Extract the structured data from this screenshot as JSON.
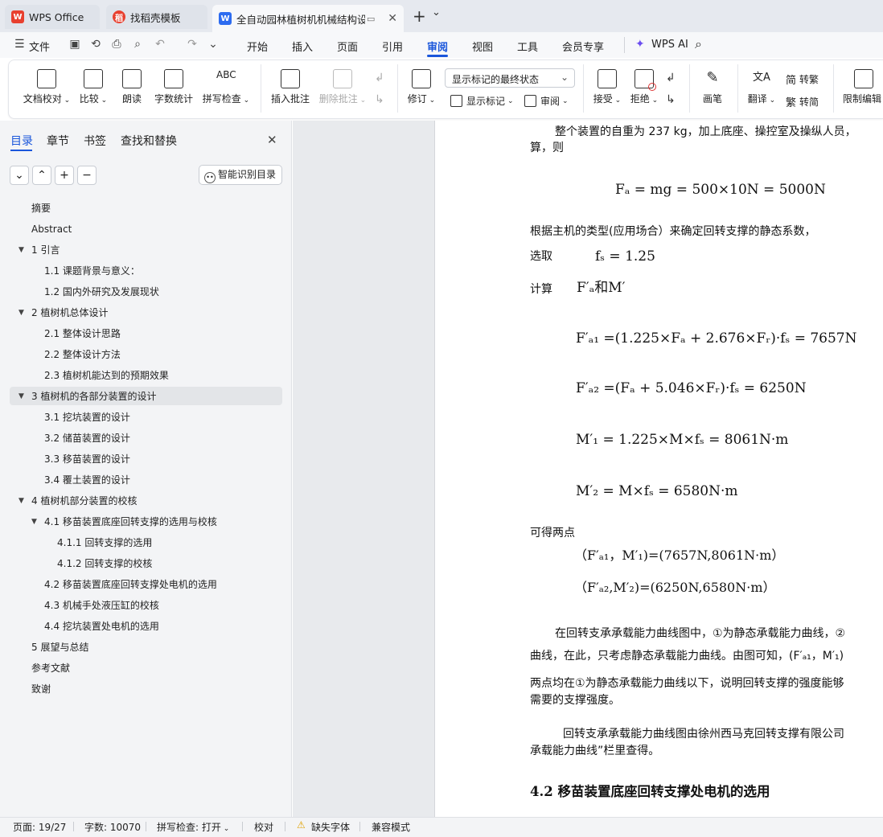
{
  "titlebar": {
    "tabs": [
      {
        "label": "WPS Office",
        "icon": "wps-logo-icon"
      },
      {
        "label": "找稻壳模板",
        "icon": "docer-icon"
      },
      {
        "label": "全自动园林植树机机械结构设计",
        "icon": "writer-doc-icon",
        "active": true
      }
    ],
    "new_tab": "+",
    "tab_menu": "⌄"
  },
  "menubar": {
    "file": "文件",
    "items": [
      "开始",
      "插入",
      "页面",
      "引用",
      "审阅",
      "视图",
      "工具",
      "会员专享"
    ],
    "active": "审阅",
    "wps_ai": "WPS AI"
  },
  "ribbon": {
    "proof": "文档校对",
    "compare": "比较",
    "read_aloud": "朗读",
    "word_count": "字数统计",
    "spell_check": "拼写检查",
    "insert_comment": "插入批注",
    "delete_comment": "删除批注",
    "track_changes": "修订",
    "markup_state": "显示标记的最终状态",
    "show_markup": "显示标记",
    "review": "审阅",
    "accept": "接受",
    "reject": "拒绝",
    "pen": "画笔",
    "translate": "翻译",
    "to_traditional": "转繁",
    "to_simplified": "转简",
    "restrict_edit": "限制编辑"
  },
  "panel": {
    "tabs": [
      "目录",
      "章节",
      "书签",
      "查找和替换"
    ],
    "active_tab": "目录",
    "smart_toc": "智能识别目录",
    "toc": [
      {
        "label": "摘要",
        "level": 0
      },
      {
        "label": "Abstract",
        "level": 0
      },
      {
        "label": "1  引言",
        "level": 0,
        "expanded": true
      },
      {
        "label": "1.1  课题背景与意义：",
        "level": 1
      },
      {
        "label": "1.2  国内外研究及发展现状",
        "level": 1
      },
      {
        "label": "2  植树机总体设计",
        "level": 0,
        "expanded": true
      },
      {
        "label": "2.1    整体设计思路",
        "level": 1
      },
      {
        "label": "2.2  整体设计方法",
        "level": 1
      },
      {
        "label": "2.3 植树机能达到的预期效果",
        "level": 1
      },
      {
        "label": "3    植树机的各部分装置的设计",
        "level": 0,
        "expanded": true,
        "selected": true
      },
      {
        "label": "3.1  挖坑装置的设计",
        "level": 1
      },
      {
        "label": "3.2  储苗装置的设计",
        "level": 1
      },
      {
        "label": "3.3    移苗装置的设计",
        "level": 1
      },
      {
        "label": "3.4    覆土装置的设计",
        "level": 1
      },
      {
        "label": "4    植树机部分装置的校核",
        "level": 0,
        "expanded": true
      },
      {
        "label": "4.1  移苗装置底座回转支撑的选用与校核",
        "level": 1,
        "expanded": true
      },
      {
        "label": "4.1.1  回转支撑的选用",
        "level": 2
      },
      {
        "label": "4.1.2 回转支撑的校核",
        "level": 2
      },
      {
        "label": "4.2 移苗装置底座回转支撑处电机的选用",
        "level": 1
      },
      {
        "label": "4.3  机械手处液压缸的校核",
        "level": 1
      },
      {
        "label": "4.4 挖坑装置处电机的选用",
        "level": 1
      },
      {
        "label": "5    展望与总结",
        "level": 0
      },
      {
        "label": "参考文献",
        "level": 0
      },
      {
        "label": "致谢",
        "level": 0
      }
    ]
  },
  "doc": {
    "p1": "整个装置的自重为 237 kg，加上底座、操控室及操纵人员，",
    "p1b": "算，则",
    "eq_fa": "Fₐ = mg = 500×10N = 5000N",
    "p2": "根据主机的类型(应用场合）来确定回转支撑的静态系数，",
    "p3_label": "选取",
    "eq_fs": "fₛ = 1.25",
    "p4_label": "计算",
    "eq_fam": "F′ₐ和M′",
    "eq1": "F′ₐ₁ =(1.225×Fₐ + 2.676×Fᵣ)·fₛ = 7657N",
    "eq2": "F′ₐ₂ =(Fₐ + 5.046×Fᵣ)·fₛ = 6250N",
    "eq3": "M′₁ = 1.225×M×fₛ = 8061N·m",
    "eq4": "M′₂ = M×fₛ = 6580N·m",
    "p5": "可得两点",
    "pt1": "（F′ₐ₁，M′₁)=(7657N,8061N·m）",
    "pt2": "（F′ₐ₂,M′₂)=(6250N,6580N·m）",
    "p6a": "在回转支承承载能力曲线图中，①为静态承载能力曲线，②",
    "p6b": "曲线，在此，只考虑静态承载能力曲线。由图可知，(F′ₐ₁，M′₁)",
    "p6c": "两点均在①为静态承载能力曲线以下，说明回转支撑的强度能够",
    "p6d": "需要的支撑强度。",
    "p7a": "回转支承承载能力曲线图由徐州西马克回转支撑有限公司",
    "p7b": "承载能力曲线”栏里查得。",
    "heading": "4.2 移苗装置底座回转支撑处电机的选用"
  },
  "statusbar": {
    "page": "页面: 19/27",
    "words": "字数: 10070",
    "spell": "拼写检查: 打开",
    "proof": "校对",
    "missing_font": "缺失字体",
    "compat": "兼容模式"
  },
  "colors": {
    "accent": "#1a56db",
    "wps_red": "#e8402f",
    "warn": "#e0a100"
  }
}
